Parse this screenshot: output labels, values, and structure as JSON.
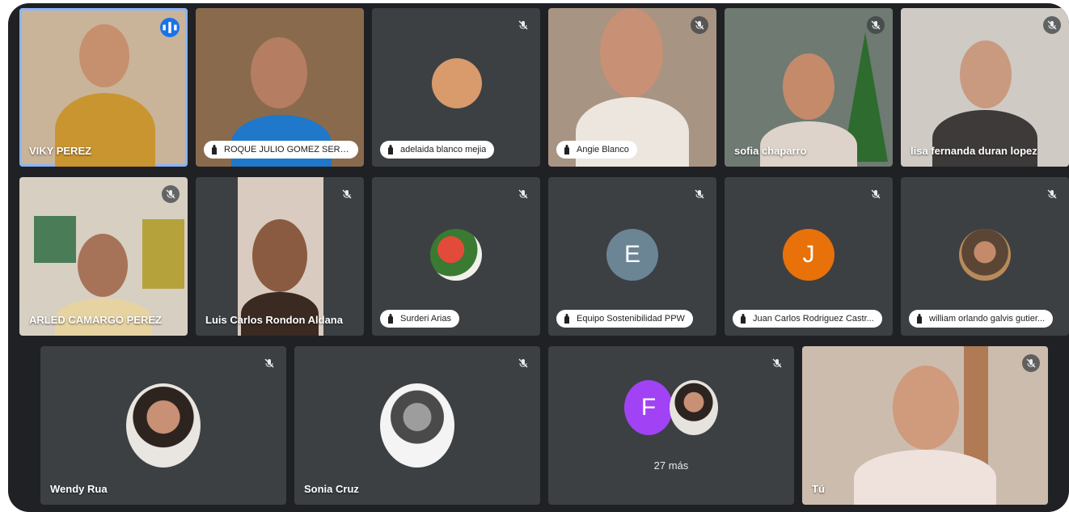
{
  "participants": [
    {
      "name": "VIKY PEREZ"
    },
    {
      "name": "ROQUE JULIO GOMEZ SERR..."
    },
    {
      "name": "adelaida blanco mejia"
    },
    {
      "name": "Angie Blanco"
    },
    {
      "name": "sofia chaparro"
    },
    {
      "name": "lisa fernanda duran lopez"
    },
    {
      "name": "ARLED CAMARGO PEREZ"
    },
    {
      "name": "Luis Carlos Rondon Aldana"
    },
    {
      "name": "Surderi Arias"
    },
    {
      "name": "Equipo Sostenibilidad PPW",
      "initial": "E",
      "avatar_color": "#6b8595"
    },
    {
      "name": "Juan Carlos Rodriguez Castr...",
      "initial": "J",
      "avatar_color": "#e8710a"
    },
    {
      "name": "william orlando galvis gutier..."
    },
    {
      "name": "Wendy Rua"
    },
    {
      "name": "Sonia Cruz"
    },
    {
      "overflow_initial": "F",
      "overflow_color": "#a142f4",
      "more_label": "27 más"
    },
    {
      "name": "Tú"
    }
  ],
  "colors": {
    "tile_bg": "#3c4043",
    "frame_bg": "#202124",
    "speaking_outline": "#8ab4f8",
    "speaking_badge": "#1a73e8"
  },
  "icons": {
    "muted": "mic-off-icon",
    "speaking": "audio-level-icon",
    "pinned": "hand-icon"
  }
}
